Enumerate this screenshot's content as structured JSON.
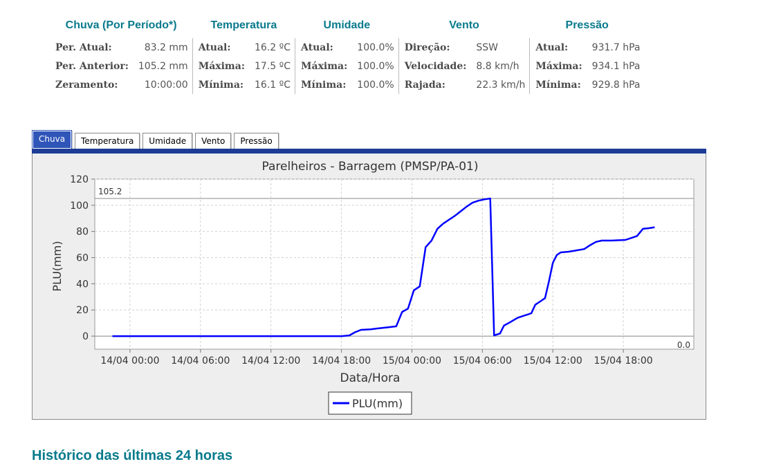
{
  "summary": {
    "headers": [
      "Chuva (Por Período*)",
      "Temperatura",
      "Umidade",
      "Vento",
      "Pressão"
    ],
    "chuva": [
      {
        "label": "Per. Atual:",
        "value": "83.2 mm"
      },
      {
        "label": "Per. Anterior:",
        "value": "105.2 mm"
      },
      {
        "label": "Zeramento:",
        "value": "10:00:00"
      }
    ],
    "temperatura": [
      {
        "label": "Atual:",
        "value": "16.2 ºC"
      },
      {
        "label": "Máxima:",
        "value": "17.5 ºC"
      },
      {
        "label": "Mínima:",
        "value": "16.1 ºC"
      }
    ],
    "umidade": [
      {
        "label": "Atual:",
        "value": "100.0%"
      },
      {
        "label": "Máxima:",
        "value": "100.0%"
      },
      {
        "label": "Mínima:",
        "value": "100.0%"
      }
    ],
    "vento": [
      {
        "label": "Direção:",
        "value": "SSW"
      },
      {
        "label": "Velocidade:",
        "value": "8.8 km/h"
      },
      {
        "label": "Rajada:",
        "value": "22.3 km/h"
      }
    ],
    "pressao": [
      {
        "label": "Atual:",
        "value": "931.7 hPa"
      },
      {
        "label": "Máxima:",
        "value": "934.1 hPa"
      },
      {
        "label": "Mínima:",
        "value": "929.8 hPa"
      }
    ]
  },
  "tabs": [
    "Chuva",
    "Temperatura",
    "Umidade",
    "Vento",
    "Pressão"
  ],
  "active_tab": 0,
  "colors": {
    "heading": "#087a8c",
    "tab_active": "#2f55b8",
    "panel_bar": "#1d3c96",
    "series": "#0000ff"
  },
  "section_heading": "Histórico das últimas 24 horas",
  "chart_data": {
    "type": "line",
    "title": "Parelheiros - Barragem (PMSP/PA-01)",
    "xlabel": "Data/Hora",
    "ylabel": "PLU(mm)",
    "x_ticks": [
      "14/04 00:00",
      "14/04 06:00",
      "14/04 12:00",
      "14/04 18:00",
      "15/04 00:00",
      "15/04 06:00",
      "15/04 12:00",
      "15/04 18:00"
    ],
    "y_ticks": [
      0,
      20,
      40,
      60,
      80,
      100,
      120
    ],
    "xlim": [
      "2024-04-13T21:00",
      "2024-04-16T00:00"
    ],
    "ylim": [
      -10,
      120
    ],
    "markers": [
      {
        "label": "105.2",
        "value": 105.2
      },
      {
        "label": "0.0",
        "value": 0.0
      }
    ],
    "legend": "bottom",
    "grid": true,
    "series": [
      {
        "name": "PLU(mm)",
        "color": "#0000ff",
        "points": [
          [
            "2024-04-13T22:30",
            0
          ],
          [
            "2024-04-14T06:00",
            0
          ],
          [
            "2024-04-14T12:00",
            0
          ],
          [
            "2024-04-14T18:00",
            0
          ],
          [
            "2024-04-14T18:40",
            0.5
          ],
          [
            "2024-04-14T19:10",
            3
          ],
          [
            "2024-04-14T19:40",
            4.8
          ],
          [
            "2024-04-14T20:30",
            5.2
          ],
          [
            "2024-04-14T21:00",
            5.8
          ],
          [
            "2024-04-14T22:00",
            6.8
          ],
          [
            "2024-04-14T22:40",
            7.5
          ],
          [
            "2024-04-14T23:10",
            18.5
          ],
          [
            "2024-04-14T23:40",
            21
          ],
          [
            "2024-04-15T00:10",
            35
          ],
          [
            "2024-04-15T00:40",
            38
          ],
          [
            "2024-04-15T01:10",
            68
          ],
          [
            "2024-04-15T01:40",
            73
          ],
          [
            "2024-04-15T02:10",
            82
          ],
          [
            "2024-04-15T02:40",
            86
          ],
          [
            "2024-04-15T03:10",
            89
          ],
          [
            "2024-04-15T03:40",
            92
          ],
          [
            "2024-04-15T04:10",
            95.5
          ],
          [
            "2024-04-15T04:40",
            99
          ],
          [
            "2024-04-15T05:10",
            102
          ],
          [
            "2024-04-15T05:40",
            103.5
          ],
          [
            "2024-04-15T06:10",
            104.5
          ],
          [
            "2024-04-15T06:40",
            105.2
          ],
          [
            "2024-04-15T07:00",
            0.5
          ],
          [
            "2024-04-15T07:30",
            2
          ],
          [
            "2024-04-15T07:50",
            8
          ],
          [
            "2024-04-15T08:20",
            10.5
          ],
          [
            "2024-04-15T09:00",
            14
          ],
          [
            "2024-04-15T09:40",
            16
          ],
          [
            "2024-04-15T10:10",
            17.5
          ],
          [
            "2024-04-15T10:30",
            24
          ],
          [
            "2024-04-15T11:00",
            27
          ],
          [
            "2024-04-15T11:20",
            29
          ],
          [
            "2024-04-15T11:40",
            42
          ],
          [
            "2024-04-15T12:00",
            56
          ],
          [
            "2024-04-15T12:20",
            62
          ],
          [
            "2024-04-15T12:40",
            64
          ],
          [
            "2024-04-15T13:20",
            64.5
          ],
          [
            "2024-04-15T14:00",
            65.5
          ],
          [
            "2024-04-15T14:40",
            66.5
          ],
          [
            "2024-04-15T15:10",
            69.5
          ],
          [
            "2024-04-15T15:40",
            72
          ],
          [
            "2024-04-15T16:10",
            73
          ],
          [
            "2024-04-15T17:00",
            73
          ],
          [
            "2024-04-15T18:10",
            73.5
          ],
          [
            "2024-04-15T18:40",
            75
          ],
          [
            "2024-04-15T19:10",
            76.5
          ],
          [
            "2024-04-15T19:40",
            82
          ],
          [
            "2024-04-15T20:10",
            82.5
          ],
          [
            "2024-04-15T20:40",
            83.2
          ]
        ]
      }
    ]
  }
}
